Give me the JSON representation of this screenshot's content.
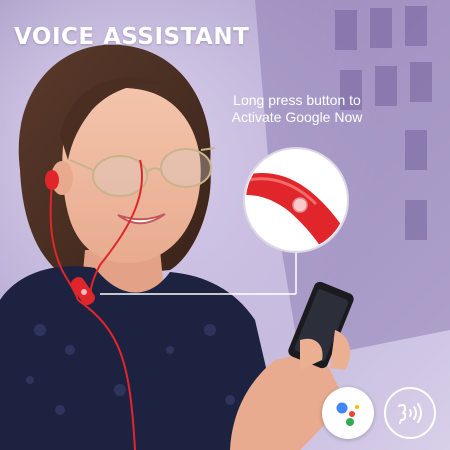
{
  "headline": "VOICE ASSISTANT",
  "callout": {
    "line1": "Long press button to",
    "line2": "Activate Google Now"
  },
  "icons": {
    "assistant": "google-assistant-icon",
    "voice": "voice-command-icon",
    "zoom": "inline-remote-closeup"
  },
  "colors": {
    "earphone_red": "#e0262b",
    "backdrop_purple": "#b6a7cf",
    "text": "#ffffff"
  }
}
